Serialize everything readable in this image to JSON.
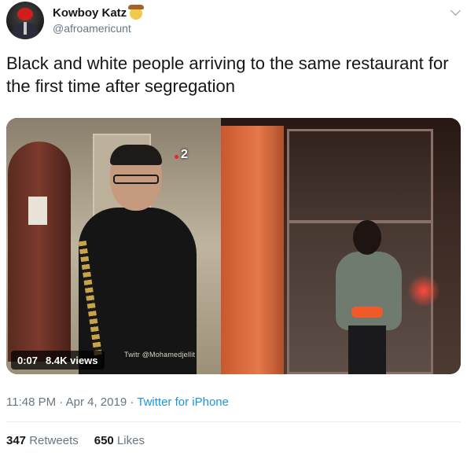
{
  "author": {
    "display_name": "Kowboy Katz",
    "name_emoji": "cowboy-face",
    "handle": "@afroamericunt"
  },
  "tweet": {
    "text": "Black and white people arriving to the same restaurant for the first time after segregation"
  },
  "video": {
    "duration": "0:07",
    "views": "8.4K views",
    "overlay_number": "2",
    "watermark": "Twitr @Mohamedjellit"
  },
  "meta": {
    "time": "11:48 PM",
    "separator": "·",
    "date": "Apr 4, 2019",
    "source": "Twitter for iPhone"
  },
  "stats": {
    "retweets_count": "347",
    "retweets_label": "Retweets",
    "likes_count": "650",
    "likes_label": "Likes"
  },
  "colors": {
    "link": "#1b95e0",
    "muted": "#657786",
    "text": "#14171a"
  }
}
